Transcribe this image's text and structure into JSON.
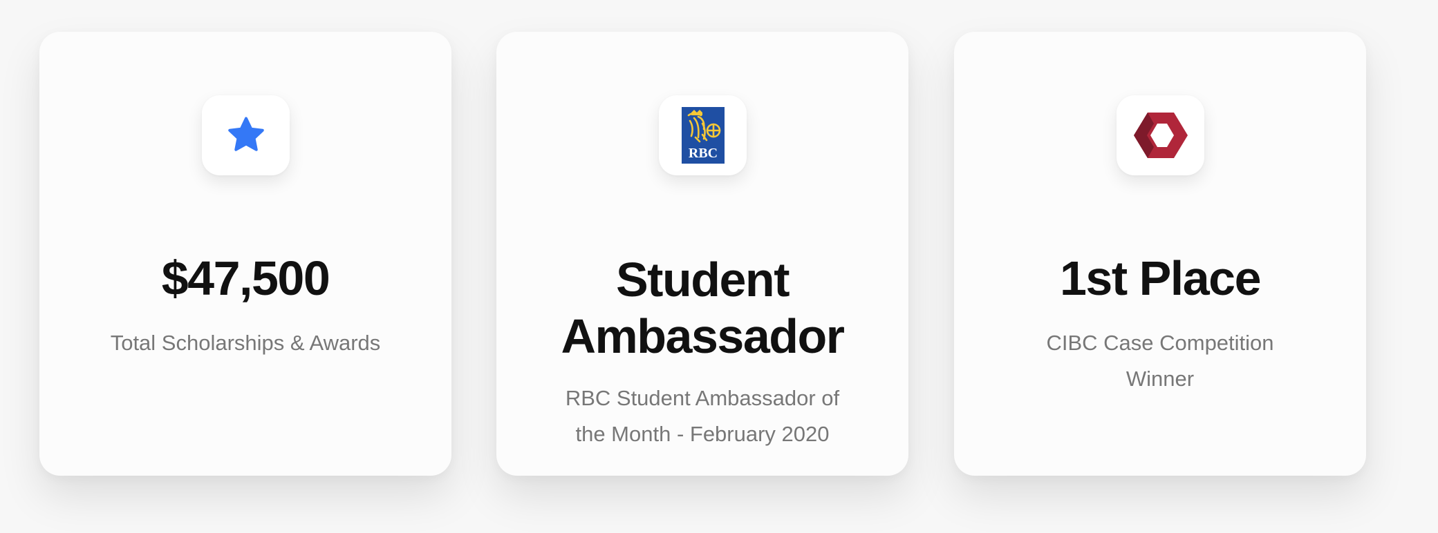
{
  "cards": [
    {
      "icon": "star-icon",
      "icon_color": "#3478f6",
      "title": "$47,500",
      "description": "Total Scholarships & Awards"
    },
    {
      "icon": "rbc-logo",
      "logo_text": "RBC",
      "logo_colors": {
        "shield": "#1f4fa3",
        "emblem": "#f6c836"
      },
      "title": "Student Ambassador",
      "description": "RBC Student Ambassador of the Month - February 2020"
    },
    {
      "icon": "cibc-logo",
      "logo_color": "#b0263a",
      "title": "1st Place",
      "description": "CIBC Case Competition Winner"
    }
  ]
}
